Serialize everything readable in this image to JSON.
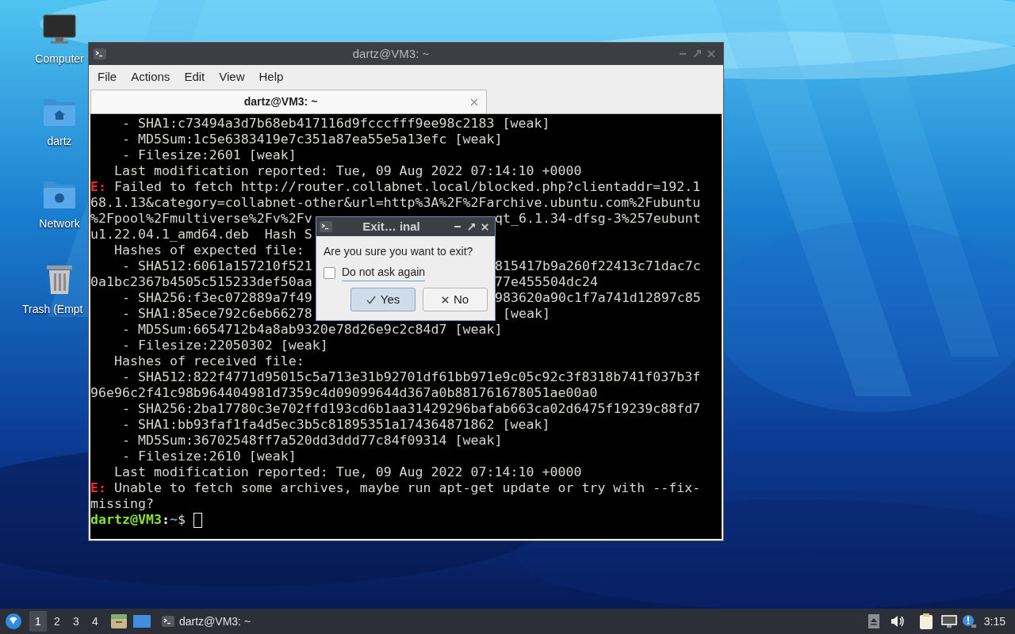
{
  "desktop_icons": [
    {
      "label": "Computer",
      "kind": "computer"
    },
    {
      "label": "dartz",
      "kind": "home"
    },
    {
      "label": "Network",
      "kind": "network"
    },
    {
      "label": "Trash (Empt",
      "kind": "trash"
    }
  ],
  "window": {
    "title": "dartz@VM3: ~",
    "menu": [
      "File",
      "Actions",
      "Edit",
      "View",
      "Help"
    ],
    "tabs": [
      {
        "label": "dartz@VM3: ~",
        "selected": true
      }
    ],
    "lines": [
      {
        "kind": "text",
        "text": "    - SHA1:c73494a3d7b68eb417116d9fcccfff9ee98c2183 [weak]"
      },
      {
        "kind": "text",
        "text": "    - MD5Sum:1c5e6383419e7c351a87ea55e5a13efc [weak]"
      },
      {
        "kind": "text",
        "text": "    - Filesize:2601 [weak]"
      },
      {
        "kind": "text",
        "text": "   Last modification reported: Tue, 09 Aug 2022 07:14:10 +0000"
      },
      {
        "kind": "error",
        "label": "E:",
        "text": " Failed to fetch http://router.collabnet.local/blocked.php?clientaddr=192.1"
      },
      {
        "kind": "text",
        "text": "68.1.13&category=collabnet-other&url=http%3A%2F%2Farchive.ubuntu.com%2Fubuntu"
      },
      {
        "kind": "split",
        "text": "%2Fpool%2Fmultiverse%2Fv%2Fv",
        "right": "qt_6.1.34-dfsg-3%257eubunt"
      },
      {
        "kind": "text",
        "text": "u1.22.04.1_amd64.deb  Hash S"
      },
      {
        "kind": "text",
        "text": "   Hashes of expected file:"
      },
      {
        "kind": "split",
        "text": "    - SHA512:6061a157210f521",
        "right": "815417b9a260f22413c71dac7c"
      },
      {
        "kind": "split",
        "text": "0a1bc2367b4505c515233def50aa",
        "right": "77e455504dc24"
      },
      {
        "kind": "split",
        "text": "    - SHA256:f3ec072889a7f49",
        "right": "983620a90c1f7a741d12897c85"
      },
      {
        "kind": "split",
        "text": "    - SHA1:85ece792c6eb66278",
        "right": " [weak]"
      },
      {
        "kind": "text",
        "text": "    - MD5Sum:6654712b4a8ab9320e78d26e9c2c84d7 [weak]"
      },
      {
        "kind": "text",
        "text": "    - Filesize:22050302 [weak]"
      },
      {
        "kind": "text",
        "text": "   Hashes of received file:"
      },
      {
        "kind": "text",
        "text": "    - SHA512:822f4771d95015c5a713e31b92701df61bb971e9c05c92c3f8318b741f037b3f"
      },
      {
        "kind": "text",
        "text": "96e96c2f41c98b964404981d7359c4d09099644d367a0b881761678051ae00a0"
      },
      {
        "kind": "text",
        "text": "    - SHA256:2ba17780c3e702ffd193cd6b1aa31429296bafab663ca02d6475f19239c88fd7"
      },
      {
        "kind": "text",
        "text": "    - SHA1:bb93faf1fa4d5ec3b5c81895351a174364871862 [weak]"
      },
      {
        "kind": "text",
        "text": "    - MD5Sum:36702548ff7a520dd3ddd77c84f09314 [weak]"
      },
      {
        "kind": "text",
        "text": "    - Filesize:2610 [weak]"
      },
      {
        "kind": "text",
        "text": "   Last modification reported: Tue, 09 Aug 2022 07:14:10 +0000"
      },
      {
        "kind": "error",
        "label": "E:",
        "text": " Unable to fetch some archives, maybe run apt-get update or try with --fix-"
      },
      {
        "kind": "text",
        "text": "missing?"
      },
      {
        "kind": "prompt",
        "user": "dartz@VM3",
        "sep": ":",
        "path": "~",
        "symbol": "$"
      }
    ]
  },
  "dialog": {
    "title": "Exit… inal",
    "message": "Are you sure you want to exit?",
    "checkbox": {
      "label": "Do not ask again",
      "checked": false
    },
    "buttons": [
      {
        "label": "Yes",
        "kind": "confirm",
        "default": true
      },
      {
        "label": "No",
        "kind": "cancel",
        "default": false
      }
    ]
  },
  "taskbar": {
    "workspaces": [
      {
        "label": "1",
        "selected": true
      },
      {
        "label": "2",
        "selected": false
      },
      {
        "label": "3",
        "selected": false
      },
      {
        "label": "4",
        "selected": false
      }
    ],
    "tasks": [
      {
        "label": "dartz@VM3: ~"
      }
    ],
    "clock": "3:15"
  }
}
